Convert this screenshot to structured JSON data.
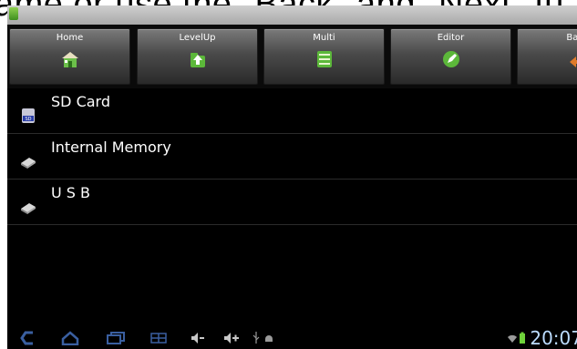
{
  "caption": {
    "text": "ame or use the \"Back\" and \"Next\" fu"
  },
  "toolbar": {
    "buttons": [
      {
        "label": "Home",
        "icon": "home-icon"
      },
      {
        "label": "LevelUp",
        "icon": "level-up-icon"
      },
      {
        "label": "Multi",
        "icon": "multi-select-icon"
      },
      {
        "label": "Editor",
        "icon": "editor-icon"
      },
      {
        "label": "Back",
        "icon": "back-icon"
      }
    ]
  },
  "storage_list": [
    {
      "label": "SD Card",
      "icon": "sd-card-icon"
    },
    {
      "label": "Internal Memory",
      "icon": "drive-icon"
    },
    {
      "label": "U S B",
      "icon": "drive-icon"
    }
  ],
  "status": {
    "time": "20:07"
  }
}
